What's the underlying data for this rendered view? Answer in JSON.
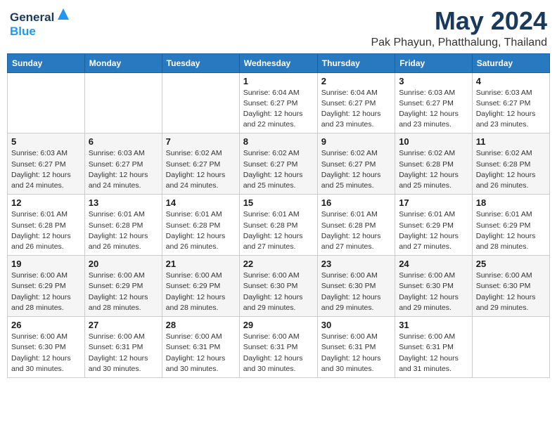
{
  "logo": {
    "line1": "General",
    "line2": "Blue"
  },
  "header": {
    "month": "May 2024",
    "location": "Pak Phayun, Phatthalung, Thailand"
  },
  "weekdays": [
    "Sunday",
    "Monday",
    "Tuesday",
    "Wednesday",
    "Thursday",
    "Friday",
    "Saturday"
  ],
  "weeks": [
    [
      {
        "day": "",
        "info": ""
      },
      {
        "day": "",
        "info": ""
      },
      {
        "day": "",
        "info": ""
      },
      {
        "day": "1",
        "info": "Sunrise: 6:04 AM\nSunset: 6:27 PM\nDaylight: 12 hours\nand 22 minutes."
      },
      {
        "day": "2",
        "info": "Sunrise: 6:04 AM\nSunset: 6:27 PM\nDaylight: 12 hours\nand 23 minutes."
      },
      {
        "day": "3",
        "info": "Sunrise: 6:03 AM\nSunset: 6:27 PM\nDaylight: 12 hours\nand 23 minutes."
      },
      {
        "day": "4",
        "info": "Sunrise: 6:03 AM\nSunset: 6:27 PM\nDaylight: 12 hours\nand 23 minutes."
      }
    ],
    [
      {
        "day": "5",
        "info": "Sunrise: 6:03 AM\nSunset: 6:27 PM\nDaylight: 12 hours\nand 24 minutes."
      },
      {
        "day": "6",
        "info": "Sunrise: 6:03 AM\nSunset: 6:27 PM\nDaylight: 12 hours\nand 24 minutes."
      },
      {
        "day": "7",
        "info": "Sunrise: 6:02 AM\nSunset: 6:27 PM\nDaylight: 12 hours\nand 24 minutes."
      },
      {
        "day": "8",
        "info": "Sunrise: 6:02 AM\nSunset: 6:27 PM\nDaylight: 12 hours\nand 25 minutes."
      },
      {
        "day": "9",
        "info": "Sunrise: 6:02 AM\nSunset: 6:27 PM\nDaylight: 12 hours\nand 25 minutes."
      },
      {
        "day": "10",
        "info": "Sunrise: 6:02 AM\nSunset: 6:28 PM\nDaylight: 12 hours\nand 25 minutes."
      },
      {
        "day": "11",
        "info": "Sunrise: 6:02 AM\nSunset: 6:28 PM\nDaylight: 12 hours\nand 26 minutes."
      }
    ],
    [
      {
        "day": "12",
        "info": "Sunrise: 6:01 AM\nSunset: 6:28 PM\nDaylight: 12 hours\nand 26 minutes."
      },
      {
        "day": "13",
        "info": "Sunrise: 6:01 AM\nSunset: 6:28 PM\nDaylight: 12 hours\nand 26 minutes."
      },
      {
        "day": "14",
        "info": "Sunrise: 6:01 AM\nSunset: 6:28 PM\nDaylight: 12 hours\nand 26 minutes."
      },
      {
        "day": "15",
        "info": "Sunrise: 6:01 AM\nSunset: 6:28 PM\nDaylight: 12 hours\nand 27 minutes."
      },
      {
        "day": "16",
        "info": "Sunrise: 6:01 AM\nSunset: 6:28 PM\nDaylight: 12 hours\nand 27 minutes."
      },
      {
        "day": "17",
        "info": "Sunrise: 6:01 AM\nSunset: 6:29 PM\nDaylight: 12 hours\nand 27 minutes."
      },
      {
        "day": "18",
        "info": "Sunrise: 6:01 AM\nSunset: 6:29 PM\nDaylight: 12 hours\nand 28 minutes."
      }
    ],
    [
      {
        "day": "19",
        "info": "Sunrise: 6:00 AM\nSunset: 6:29 PM\nDaylight: 12 hours\nand 28 minutes."
      },
      {
        "day": "20",
        "info": "Sunrise: 6:00 AM\nSunset: 6:29 PM\nDaylight: 12 hours\nand 28 minutes."
      },
      {
        "day": "21",
        "info": "Sunrise: 6:00 AM\nSunset: 6:29 PM\nDaylight: 12 hours\nand 28 minutes."
      },
      {
        "day": "22",
        "info": "Sunrise: 6:00 AM\nSunset: 6:30 PM\nDaylight: 12 hours\nand 29 minutes."
      },
      {
        "day": "23",
        "info": "Sunrise: 6:00 AM\nSunset: 6:30 PM\nDaylight: 12 hours\nand 29 minutes."
      },
      {
        "day": "24",
        "info": "Sunrise: 6:00 AM\nSunset: 6:30 PM\nDaylight: 12 hours\nand 29 minutes."
      },
      {
        "day": "25",
        "info": "Sunrise: 6:00 AM\nSunset: 6:30 PM\nDaylight: 12 hours\nand 29 minutes."
      }
    ],
    [
      {
        "day": "26",
        "info": "Sunrise: 6:00 AM\nSunset: 6:30 PM\nDaylight: 12 hours\nand 30 minutes."
      },
      {
        "day": "27",
        "info": "Sunrise: 6:00 AM\nSunset: 6:31 PM\nDaylight: 12 hours\nand 30 minutes."
      },
      {
        "day": "28",
        "info": "Sunrise: 6:00 AM\nSunset: 6:31 PM\nDaylight: 12 hours\nand 30 minutes."
      },
      {
        "day": "29",
        "info": "Sunrise: 6:00 AM\nSunset: 6:31 PM\nDaylight: 12 hours\nand 30 minutes."
      },
      {
        "day": "30",
        "info": "Sunrise: 6:00 AM\nSunset: 6:31 PM\nDaylight: 12 hours\nand 30 minutes."
      },
      {
        "day": "31",
        "info": "Sunrise: 6:00 AM\nSunset: 6:31 PM\nDaylight: 12 hours\nand 31 minutes."
      },
      {
        "day": "",
        "info": ""
      }
    ]
  ]
}
